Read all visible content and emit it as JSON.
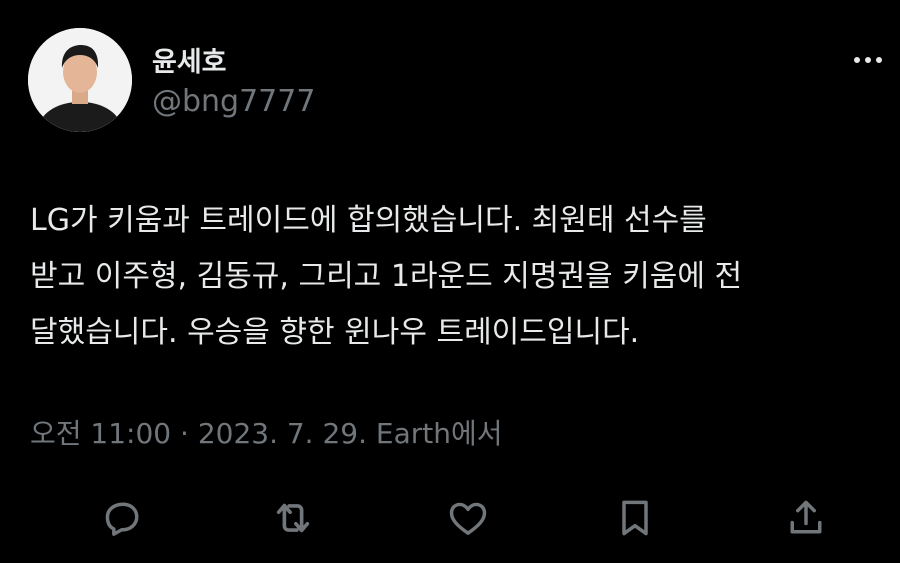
{
  "author": {
    "display_name": "윤세호",
    "handle": "@bng7777"
  },
  "tweet": {
    "text": "LG가 키움과 트레이드에 합의했습니다. 최원태 선수를\n받고 이주형, 김동규, 그리고 1라운드 지명권을 키움에 전\n달했습니다. 우승을 향한 윈나우 트레이드입니다.",
    "meta": "오전 11:00 · 2023. 7. 29. Earth에서"
  },
  "icons": {
    "more": "more-horizontal-icon",
    "reply": "reply-icon",
    "retweet": "retweet-icon",
    "like": "heart-icon",
    "bookmark": "bookmark-icon",
    "share": "share-icon"
  },
  "colors": {
    "background": "#000000",
    "primary_text": "#e7e9ea",
    "secondary_text": "#71767b",
    "icon": "#71767b"
  }
}
